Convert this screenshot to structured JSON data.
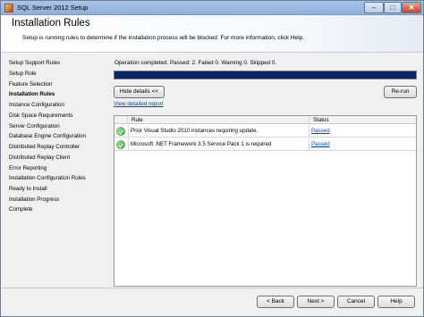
{
  "window": {
    "title": "SQL Server 2012 Setup",
    "controls": {
      "minimize": "–",
      "maximize": "□",
      "close": "✕"
    }
  },
  "header": {
    "title": "Installation Rules",
    "description": "Setup is running rules to determine if the installation process will be blocked. For more information, click Help."
  },
  "sidebar": {
    "items": [
      {
        "label": "Setup Support Rules",
        "active": false
      },
      {
        "label": "Setup Role",
        "active": false
      },
      {
        "label": "Feature Selection",
        "active": false
      },
      {
        "label": "Installation Rules",
        "active": true
      },
      {
        "label": "Instance Configuration",
        "active": false
      },
      {
        "label": "Disk Space Requirements",
        "active": false
      },
      {
        "label": "Server Configuration",
        "active": false
      },
      {
        "label": "Database Engine Configuration",
        "active": false
      },
      {
        "label": "Distributed Replay Controller",
        "active": false
      },
      {
        "label": "Distributed Replay Client",
        "active": false
      },
      {
        "label": "Error Reporting",
        "active": false
      },
      {
        "label": "Installation Configuration Rules",
        "active": false
      },
      {
        "label": "Ready to Install",
        "active": false
      },
      {
        "label": "Installation Progress",
        "active": false
      },
      {
        "label": "Complete",
        "active": false
      }
    ]
  },
  "main": {
    "status_text": "Operation completed.  Passed: 2.   Failed 0.   Warning 0.   Skipped 0.",
    "progress_percent": 100,
    "progress_color": "#0a246a",
    "hide_details_label": "Hide details <<",
    "rerun_label": "Re-run",
    "view_report_label": "View detailed report",
    "table": {
      "columns": [
        "Rule",
        "Status"
      ],
      "rows": [
        {
          "icon": "passed-check-icon",
          "rule": "Prior Visual Studio 2010 instances requiring update.",
          "status": "Passed"
        },
        {
          "icon": "passed-check-icon",
          "rule": "Microsoft .NET Framework 3.5 Service Pack 1 is required",
          "status": "Passed"
        }
      ]
    }
  },
  "footer": {
    "back_label": "< Back",
    "next_label": "Next >",
    "cancel_label": "Cancel",
    "help_label": "Help"
  }
}
